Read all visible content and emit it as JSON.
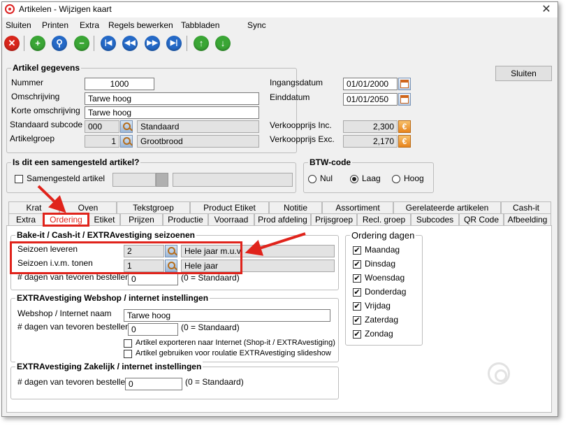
{
  "window": {
    "title": "Artikelen - Wijzigen kaart"
  },
  "menu": [
    {
      "label": "Sluiten"
    },
    {
      "label": "Printen"
    },
    {
      "label": "Extra"
    },
    {
      "label": "Regels bewerken"
    },
    {
      "label": "Tabbladen"
    },
    {
      "label": "Sync"
    }
  ],
  "toolbar": [
    {
      "name": "close-record",
      "icon": "x-icon"
    },
    {
      "name": "add",
      "icon": "plus-icon"
    },
    {
      "name": "search",
      "icon": "search-icon"
    },
    {
      "name": "remove",
      "icon": "minus-icon"
    },
    {
      "name": "first",
      "icon": "first-icon"
    },
    {
      "name": "previous",
      "icon": "previous-icon"
    },
    {
      "name": "next",
      "icon": "next-icon"
    },
    {
      "name": "last",
      "icon": "last-icon"
    },
    {
      "name": "up",
      "icon": "arrow-up-icon"
    },
    {
      "name": "down",
      "icon": "arrow-down-icon"
    }
  ],
  "artikel": {
    "legend": "Artikel gegevens",
    "nummer_label": "Nummer",
    "nummer": "1000",
    "omschrijving_label": "Omschrijving",
    "omschrijving": "Tarwe hoog",
    "korte_label": "Korte omschrijving",
    "korte": "Tarwe hoog",
    "subcode_label": "Standaard subcode",
    "subcode": "000",
    "subcode_name": "Standaard",
    "groep_label": "Artikelgroep",
    "groep": "1",
    "groep_name": "Grootbrood",
    "ingang_label": "Ingangsdatum",
    "ingang": "01/01/2000",
    "eind_label": "Einddatum",
    "eind": "01/01/2050",
    "vpi_label": "Verkoopprijs Inc.",
    "vpi": "2,300",
    "vpe_label": "Verkoopprijs Exc.",
    "vpe": "2,170",
    "euro_symbol": "€"
  },
  "sluiten_button": "Sluiten",
  "samengesteld": {
    "legend": "Is dit een samengesteld artikel?",
    "checkbox_label": "Samengesteld artikel"
  },
  "btw": {
    "legend": "BTW-code",
    "options": [
      "Nul",
      "Laag",
      "Hoog"
    ],
    "selected": "Laag"
  },
  "tabs_row1": [
    "Krat",
    "Oven",
    "Tekstgroep",
    "Product Etiket",
    "Notitie",
    "Assortiment",
    "Gerelateerde artikelen",
    "Cash-it"
  ],
  "tabs_row2": [
    "Extra",
    "Ordering",
    "Etiket",
    "Prijzen",
    "Productie",
    "Voorraad",
    "Prod afdeling",
    "Prijsgroep",
    "Recl. groep",
    "Subcodes",
    "QR Code",
    "Afbeelding"
  ],
  "active_tab": "Ordering",
  "seizoenen": {
    "legend": "Bake-it / Cash-it / EXTRAvestiging seizoenen",
    "leveren_label": "Seizoen leveren",
    "leveren_code": "2",
    "leveren_name": "Hele jaar m.u.v.",
    "tonen_label": "Seizoen i.v.m. tonen",
    "tonen_code": "1",
    "tonen_name": "Hele jaar",
    "dagen_label": "# dagen van tevoren bestellen",
    "dagen": "0",
    "standaard_note": "(0 = Standaard)"
  },
  "webshop": {
    "legend": "EXTRAvestiging Webshop / internet instellingen",
    "naam_label": "Webshop / Internet naam",
    "naam": "Tarwe hoog",
    "dagen_label": "# dagen van tevoren bestellen",
    "dagen": "0",
    "standaard_note": "(0 = Standaard)",
    "export_label": "Artikel exporteren naar Internet (Shop-it / EXTRAvestiging)",
    "slideshow_label": "Artikel gebruiken voor roulatie EXTRAvestiging slideshow"
  },
  "zakelijk": {
    "legend": "EXTRAvestiging Zakelijk / internet instellingen",
    "dagen_label": "# dagen van tevoren bestellen",
    "dagen": "0",
    "standaard_note": "(0 = Standaard)"
  },
  "ordering_dagen": {
    "legend": "Ordering dagen",
    "days": [
      "Maandag",
      "Dinsdag",
      "Woensdag",
      "Donderdag",
      "Vrijdag",
      "Zaterdag",
      "Zondag"
    ],
    "check_mark": "✔"
  },
  "colors": {
    "annotation": "#e0231b",
    "toolbar_red": "#d8261c",
    "toolbar_green": "#3aa635",
    "toolbar_blue": "#2469c7"
  }
}
